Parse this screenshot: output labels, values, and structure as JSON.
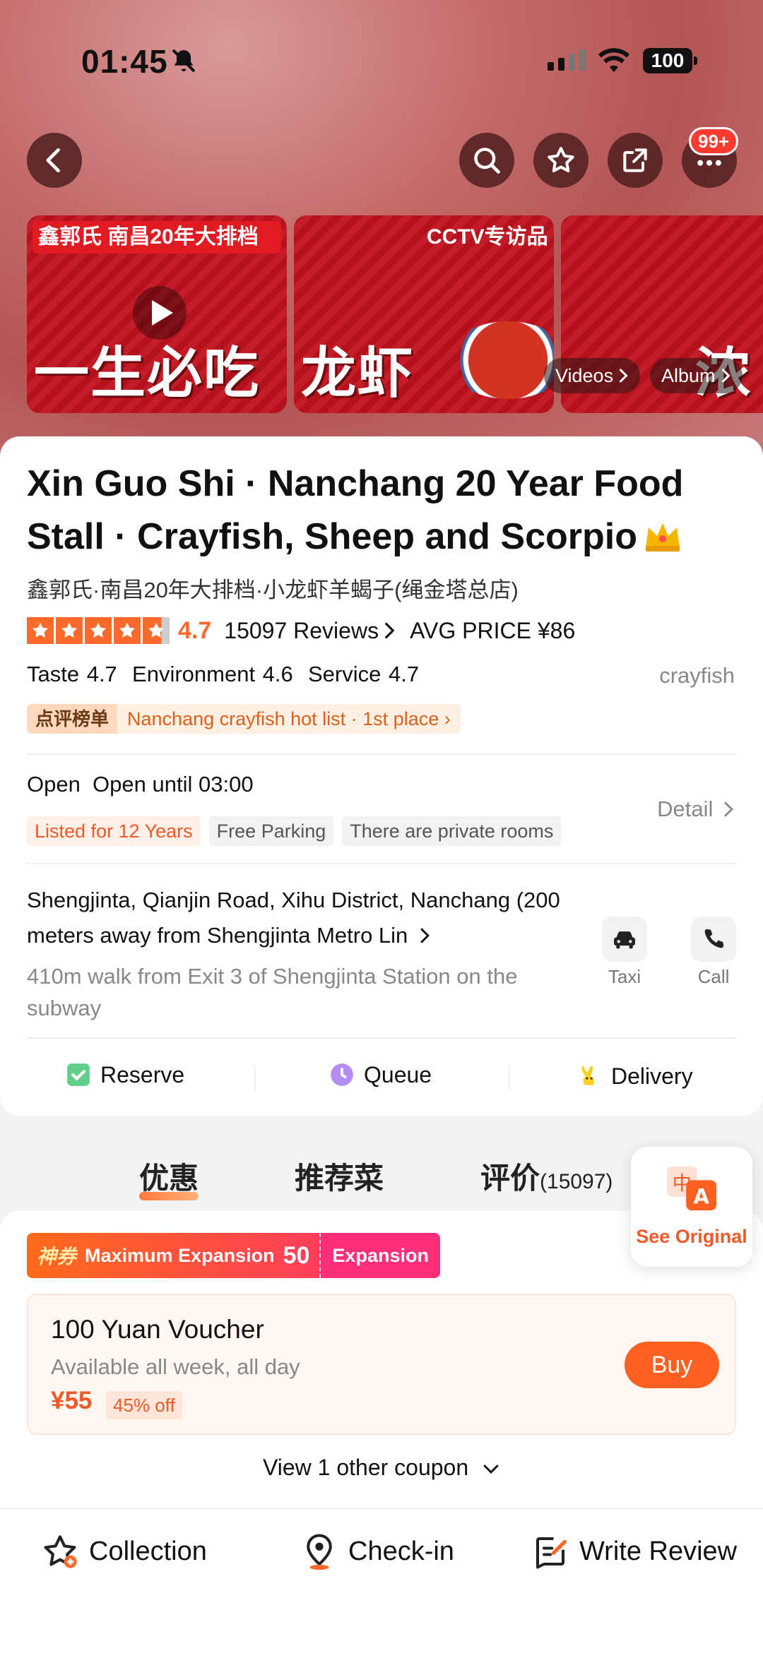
{
  "status_bar": {
    "time": "01:45",
    "battery": "100"
  },
  "nav": {
    "more_badge": "99+"
  },
  "media": {
    "tile1_band": "鑫郭氏 南昌20年大排档",
    "tile1_big": "一生必吃",
    "tile2_band": "CCTV专访品牌",
    "tile2_big": "龙虾",
    "tile3_big": "浓",
    "videos_label": "Videos",
    "album_label": "Album"
  },
  "shop": {
    "title": "Xin Guo Shi · Nanchang 20 Year Food Stall · Crayfish, Sheep and Scorpio",
    "original_name": "鑫郭氏·南昌20年大排档·小龙虾羊蝎子(绳金塔总店)",
    "score": "4.7",
    "reviews": "15097 Reviews",
    "avg_price": "AVG PRICE ¥86",
    "subscores": "Taste 4.7  Environment 4.6  Service 4.7",
    "cuisine": "crayfish",
    "rank_tag": "点评榜单",
    "rank_text": "Nanchang crayfish hot list · 1st place",
    "open_text": "Open  Open until 03:00",
    "tags": [
      "Listed for 12 Years",
      "Free Parking",
      "There are private rooms"
    ],
    "detail_label": "Detail",
    "address": "Shengjinta, Qianjin Road, Xihu District, Nanchang (200 meters away from Shengjinta Metro Lin",
    "walk": "410m walk from Exit 3 of Shengjinta Station on the subway",
    "taxi_label": "Taxi",
    "call_label": "Call"
  },
  "services": {
    "reserve": "Reserve",
    "queue": "Queue",
    "delivery": "Delivery"
  },
  "tabs": {
    "deals": "优惠",
    "dishes": "推荐菜",
    "reviews": "评价",
    "reviews_count": "(15097)"
  },
  "translate": {
    "label": "See Original",
    "icon_a": "A",
    "icon_zh": "中"
  },
  "deals": {
    "promo_tag": "神券",
    "promo_text": "Maximum Expansion",
    "promo_amount": "50",
    "expansion": "Expansion",
    "voucher_title": "100 Yuan Voucher",
    "voucher_sub": "Available all week, all day",
    "price": "¥55",
    "discount": "45% off",
    "buy": "Buy",
    "more": "View 1 other coupon"
  },
  "bottom_bar": {
    "collection": "Collection",
    "checkin": "Check-in",
    "review": "Write Review"
  },
  "colors": {
    "accent": "#ff6a2a",
    "buy": "#ff5f1f",
    "promo_pink": "#ff2e7a"
  }
}
